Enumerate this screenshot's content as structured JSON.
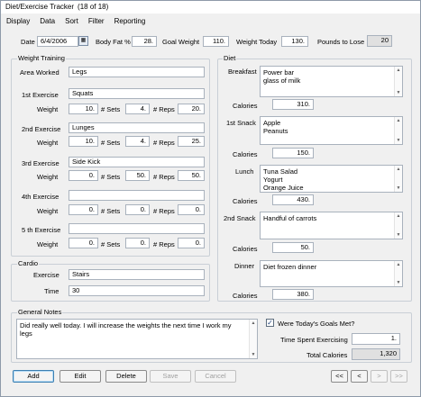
{
  "window": {
    "title": "Diet/Exercise Tracker",
    "count": "(18 of 18)"
  },
  "menu": [
    "Display",
    "Data",
    "Sort",
    "Filter",
    "Reporting"
  ],
  "header": {
    "date_label": "Date",
    "date_value": "6/4/2006",
    "body_fat_label": "Body Fat %",
    "body_fat_value": "28.",
    "goal_weight_label": "Goal Weight",
    "goal_weight_value": "110.",
    "weight_today_label": "Weight Today",
    "weight_today_value": "130.",
    "pounds_to_lose_label": "Pounds to Lose",
    "pounds_to_lose_value": "20"
  },
  "weight_training": {
    "title": "Weight Training",
    "area_label": "Area Worked",
    "area_value": "Legs",
    "exercises": [
      {
        "label": "1st Exercise",
        "name": "Squats",
        "weight": "10.",
        "sets": "4.",
        "reps": "20."
      },
      {
        "label": "2nd Exercise",
        "name": "Lunges",
        "weight": "10.",
        "sets": "4.",
        "reps": "25."
      },
      {
        "label": "3rd Exercise",
        "name": "Side Kick",
        "weight": "0.",
        "sets": "50.",
        "reps": "50."
      },
      {
        "label": "4th Exercise",
        "name": "",
        "weight": "0.",
        "sets": "0.",
        "reps": "0."
      },
      {
        "label": "5 th Exercise",
        "name": "",
        "weight": "0.",
        "sets": "0.",
        "reps": "0."
      }
    ],
    "weight_label": "Weight",
    "sets_label": "# Sets",
    "reps_label": "# Reps"
  },
  "cardio": {
    "title": "Cardio",
    "exercise_label": "Exercise",
    "exercise_value": "Stairs",
    "time_label": "Time",
    "time_value": "30"
  },
  "diet": {
    "title": "Diet",
    "calories_label": "Calories",
    "meals": [
      {
        "label": "Breakfast",
        "lines": [
          "Power bar",
          "glass of milk"
        ],
        "calories": "310."
      },
      {
        "label": "1st Snack",
        "lines": [
          "Apple",
          "Peanuts"
        ],
        "calories": "150."
      },
      {
        "label": "Lunch",
        "lines": [
          "Tuna Salad",
          "Yogurt",
          "Orange Juice"
        ],
        "calories": "430."
      },
      {
        "label": "2nd Snack",
        "lines": [
          "Handful of carrots"
        ],
        "calories": "50."
      },
      {
        "label": "Dinner",
        "lines": [
          "Diet frozen dinner"
        ],
        "calories": "380."
      }
    ]
  },
  "notes": {
    "title": "General Notes",
    "text": "Did really well today. I will increase the weights the next time I work my legs"
  },
  "goals": {
    "goals_met_label": "Were Today's Goals Met?",
    "goals_met_checked": "✓",
    "time_label": "Time Spent Exercising",
    "time_value": "1.",
    "total_label": "Total Calories",
    "total_value": "1,320"
  },
  "buttons": {
    "add": "Add",
    "edit": "Edit",
    "delete": "Delete",
    "save": "Save",
    "cancel": "Cancel",
    "first": "<<",
    "prev": "<",
    "next": ">",
    "last": ">>"
  },
  "icons": {
    "calendar": "calendar-icon",
    "scroll_up": "▲",
    "scroll_down": "▼"
  }
}
